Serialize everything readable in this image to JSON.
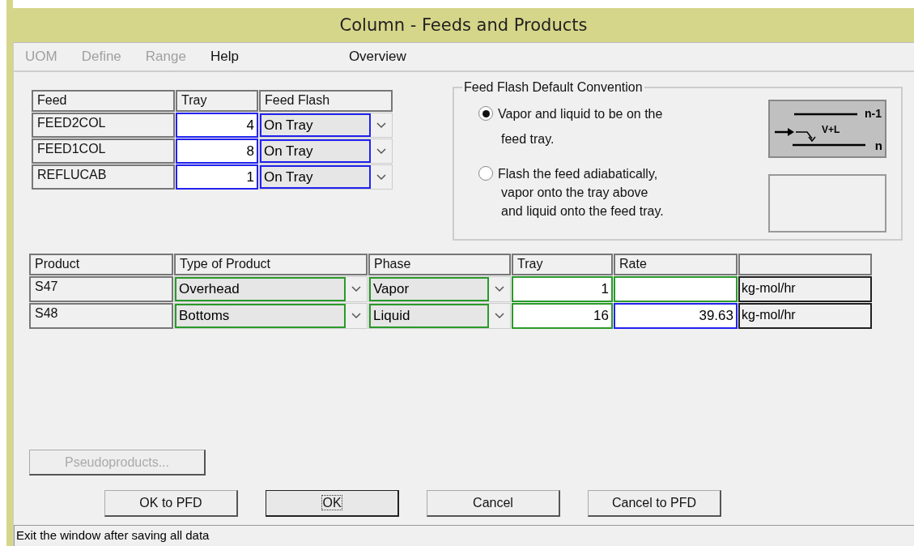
{
  "window": {
    "title": "Column - Feeds and Products"
  },
  "menu": [
    {
      "label": "UOM",
      "disabled": true
    },
    {
      "label": "Define",
      "disabled": true
    },
    {
      "label": "Range",
      "disabled": true
    },
    {
      "label": "Help",
      "disabled": false
    },
    {
      "label": "Overview",
      "disabled": false
    }
  ],
  "feeds": {
    "columns": [
      "Feed",
      "Tray",
      "Feed Flash"
    ],
    "rows": [
      {
        "name": "FEED2COL",
        "tray": "4",
        "flash": "On Tray"
      },
      {
        "name": "FEED1COL",
        "tray": "8",
        "flash": "On Tray"
      },
      {
        "name": "REFLUCAB",
        "tray": "1",
        "flash": "On Tray"
      }
    ]
  },
  "convention": {
    "title": "Feed Flash Default Convention",
    "options": [
      {
        "lines": [
          "Vapor and liquid to be on the",
          "feed tray."
        ],
        "selected": true
      },
      {
        "lines": [
          "Flash the feed adiabatically,",
          "vapor onto the tray above",
          "and liquid onto the feed tray."
        ],
        "selected": false
      }
    ],
    "diagram": {
      "upper_tray": "n-1",
      "mix": "V+L",
      "feed_tray": "n"
    }
  },
  "products": {
    "columns": [
      "Product",
      "Type of Product",
      "Phase",
      "Tray",
      "Rate"
    ],
    "rows": [
      {
        "name": "S47",
        "type": "Overhead",
        "phase": "Vapor",
        "tray": "1",
        "rate": "",
        "rate_specified": false,
        "unit": "kg-mol/hr"
      },
      {
        "name": "S48",
        "type": "Bottoms",
        "phase": "Liquid",
        "tray": "16",
        "rate": "39.63",
        "rate_specified": true,
        "unit": "kg-mol/hr"
      }
    ]
  },
  "pseudoproducts": {
    "label": "Pseudoproducts...",
    "disabled": true
  },
  "buttons": [
    {
      "label": "OK to PFD",
      "focused": false
    },
    {
      "label": "OK",
      "focused": true
    },
    {
      "label": "Cancel",
      "focused": false
    },
    {
      "label": "Cancel to PFD",
      "focused": false
    }
  ],
  "status_bar": "Exit the window after saving all data"
}
